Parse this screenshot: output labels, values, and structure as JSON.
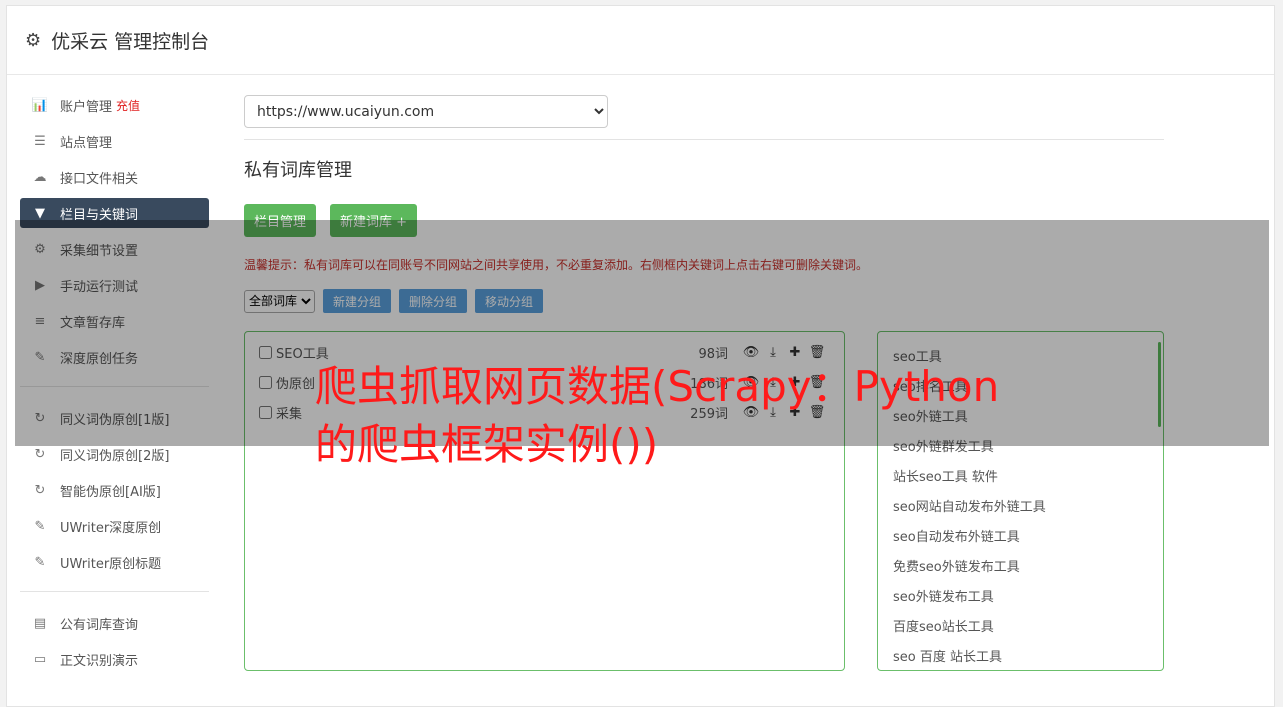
{
  "header": {
    "title": "优采云 管理控制台",
    "icon": "gear-icon"
  },
  "sidebar": {
    "group1": [
      {
        "label": "账户管理",
        "badge": "充值",
        "icon": "bar-chart-icon",
        "glyph": "📊"
      },
      {
        "label": "站点管理",
        "icon": "server-icon",
        "glyph": "☰"
      },
      {
        "label": "接口文件相关",
        "icon": "cloud-upload-icon",
        "glyph": "☁"
      },
      {
        "label": "栏目与关键词",
        "icon": "filter-icon",
        "glyph": "▼",
        "active": true
      },
      {
        "label": "采集细节设置",
        "icon": "cogs-icon",
        "glyph": "⚙"
      },
      {
        "label": "手动运行测试",
        "icon": "play-circle-icon",
        "glyph": "▶"
      },
      {
        "label": "文章暂存库",
        "icon": "database-icon",
        "glyph": "≡"
      },
      {
        "label": "深度原创任务",
        "icon": "edit-icon",
        "glyph": "✎"
      }
    ],
    "group2": [
      {
        "label": "同义词伪原创[1版]",
        "icon": "refresh-icon",
        "glyph": "↻"
      },
      {
        "label": "同义词伪原创[2版]",
        "icon": "refresh-icon",
        "glyph": "↻"
      },
      {
        "label": "智能伪原创[AI版]",
        "icon": "refresh-icon",
        "glyph": "↻"
      },
      {
        "label": "UWriter深度原创",
        "icon": "edit-icon",
        "glyph": "✎"
      },
      {
        "label": "UWriter原创标题",
        "icon": "edit-icon",
        "glyph": "✎"
      }
    ],
    "group3": [
      {
        "label": "公有词库查询",
        "icon": "book-icon",
        "glyph": "▤"
      },
      {
        "label": "正文识别演示",
        "icon": "monitor-icon",
        "glyph": "▭"
      }
    ]
  },
  "main": {
    "site_select": "https://www.ucaiyun.com",
    "section_title": "私有词库管理",
    "buttons": {
      "column_manage": "栏目管理",
      "new_library": "新建词库 +"
    },
    "tip": "温馨提示：私有词库可以在同账号不同网站之间共享使用，不必重复添加。右侧框内关键词上点击右键可删除关键词。",
    "filter_select": "全部词库",
    "group_buttons": {
      "new_group": "新建分组",
      "delete_group": "删除分组",
      "move_group": "移动分组"
    },
    "libraries": [
      {
        "name": "SEO工具",
        "count": "98词"
      },
      {
        "name": "伪原创",
        "count": "186词"
      },
      {
        "name": "采集",
        "count": "259词"
      }
    ],
    "keywords": [
      "seo工具",
      "seo排名工具",
      "seo外链工具",
      "seo外链群发工具",
      "站长seo工具 软件",
      "seo网站自动发布外链工具",
      "seo自动发布外链工具",
      "免费seo外链发布工具",
      "seo外链发布工具",
      "百度seo站长工具",
      "seo 百度 站长工具"
    ]
  },
  "overlay": {
    "text": "爬虫抓取网页数据(Scrapy：Python的爬虫框架实例())"
  },
  "colors": {
    "accent_green": "#5cb85c",
    "accent_blue": "#5aa0dd",
    "active_nav": "#394a5e",
    "overlay_text": "#ff1a1a"
  }
}
